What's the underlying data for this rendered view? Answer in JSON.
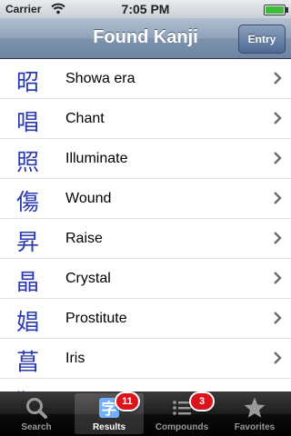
{
  "status_bar": {
    "carrier": "Carrier",
    "time": "7:05 PM"
  },
  "nav": {
    "title": "Found Kanji",
    "right_button": "Entry"
  },
  "kanji_list": [
    {
      "kanji": "昭",
      "meaning": "Showa era"
    },
    {
      "kanji": "唱",
      "meaning": "Chant"
    },
    {
      "kanji": "照",
      "meaning": "Illuminate"
    },
    {
      "kanji": "傷",
      "meaning": "Wound"
    },
    {
      "kanji": "昇",
      "meaning": "Raise"
    },
    {
      "kanji": "晶",
      "meaning": "Crystal"
    },
    {
      "kanji": "娼",
      "meaning": "Prostitute"
    },
    {
      "kanji": "菖",
      "meaning": "Iris"
    },
    {
      "kanji": "猩",
      "meaning": ""
    }
  ],
  "tabs": [
    {
      "label": "Search",
      "icon": "magnifier-icon",
      "badge": "",
      "selected": false
    },
    {
      "label": "Results",
      "icon": "kanji-character-icon",
      "badge": "11",
      "selected": true
    },
    {
      "label": "Compounds",
      "icon": "list-icon",
      "badge": "3",
      "selected": false
    },
    {
      "label": "Favorites",
      "icon": "star-icon",
      "badge": "",
      "selected": false
    }
  ],
  "colors": {
    "kanji_text": "#2a3ab0",
    "badge": "#d9141a",
    "nav_bar": "#6d85a3"
  }
}
